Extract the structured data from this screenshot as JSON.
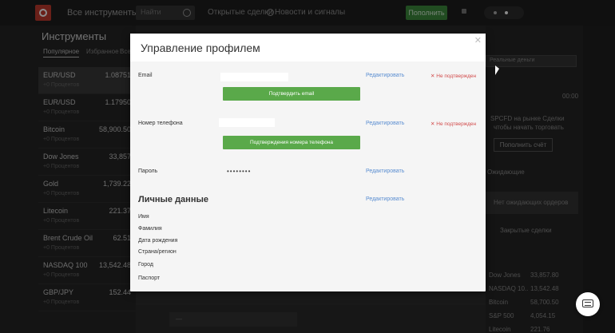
{
  "topbar": {
    "all_instruments": "Все инструменты",
    "search_placeholder": "Найти",
    "open_trades": "Открытые сделки",
    "news_signals": "Новости и сигналы",
    "deposit_label": "Пополнить"
  },
  "instruments": {
    "title": "Инструменты",
    "tabs": [
      "Популярное",
      "Избранное",
      "Все"
    ],
    "rows": [
      {
        "name": "EUR/USD",
        "price": "1.08751",
        "sub": "+0 Процентов"
      },
      {
        "name": "EUR/USD",
        "price": "1.17950",
        "sub": "+0 Процентов"
      },
      {
        "name": "Bitcoin",
        "price": "58,900.50",
        "sub": "+0 Процентов"
      },
      {
        "name": "Dow Jones",
        "price": "33,857",
        "sub": "+0 Процентов"
      },
      {
        "name": "Gold",
        "price": "1,739.22",
        "sub": "+0 Процентов"
      },
      {
        "name": "Litecoin",
        "price": "221.37",
        "sub": "+0 Процентов"
      },
      {
        "name": "Brent Crude Oil",
        "price": "62.51",
        "sub": "+0 Процентов"
      },
      {
        "name": "NASDAQ 100",
        "price": "13,542.48",
        "sub": "+0 Процентов"
      },
      {
        "name": "GBP/JPY",
        "price": "152.44",
        "sub": "+0 Процентов"
      }
    ]
  },
  "right_panel": {
    "select_label": "Реальные деньги",
    "time": "00:00",
    "promo_line1": "SPCFD на рынке Сделки",
    "promo_line2": "чтобы начать торговать",
    "promo_button": "Пополнить счёт",
    "pending_label": "Ожидающие",
    "empty_box": "Нет ожидающих ордеров",
    "closed_label": "Закрытые сделки",
    "closed_items": [
      {
        "name": "Dow Jones",
        "val": "33,857.80"
      },
      {
        "name": "NASDAQ 10..",
        "val": "13,542.48"
      },
      {
        "name": "Bitcoin",
        "val": "58,700.50"
      },
      {
        "name": "S&P 500",
        "val": "4,054.15"
      },
      {
        "name": "Litecoin",
        "val": "221.76"
      }
    ]
  },
  "modal": {
    "title": "Управление профилем",
    "email_label": "Email",
    "email_edit": "Редактировать",
    "email_status": "✕ Не подтвержден",
    "email_confirm_button": "Подтвердить email",
    "phone_label": "Номер телефона",
    "phone_edit": "Редактировать",
    "phone_status": "✕ Не подтвержден",
    "phone_confirm_button": "Подтверждения номера телефона",
    "password_label": "Пароль",
    "password_value": "••••••••",
    "password_edit": "Редактировать",
    "personal_title": "Личные данные",
    "personal_edit": "Редактировать",
    "fields": [
      "Имя",
      "Фамилия",
      "Дата рождения",
      "Страна/регион",
      "Город",
      "Паспорт"
    ]
  }
}
